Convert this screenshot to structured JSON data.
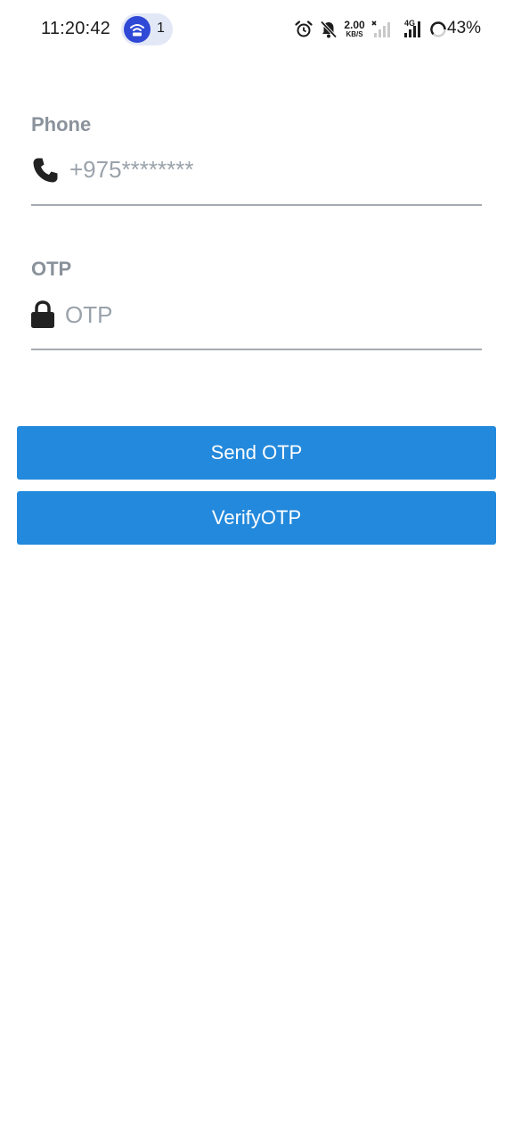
{
  "status_bar": {
    "time": "11:20:42",
    "hotspot_count": "1",
    "net_speed_value": "2.00",
    "net_speed_unit": "KB/S",
    "network_type": "4G",
    "battery": "43%"
  },
  "form": {
    "phone": {
      "label": "Phone",
      "placeholder": "+975********",
      "value": "",
      "icon": "phone-icon"
    },
    "otp": {
      "label": "OTP",
      "placeholder": "OTP",
      "value": "",
      "icon": "lock-icon"
    }
  },
  "buttons": {
    "send_otp": "Send OTP",
    "verify_otp": "VerifyOTP"
  },
  "colors": {
    "accent": "#2389dc",
    "label": "#8a929b",
    "placeholder": "#9aa2aa",
    "underline": "#a4aab0",
    "hotspot": "#2f49d6"
  }
}
